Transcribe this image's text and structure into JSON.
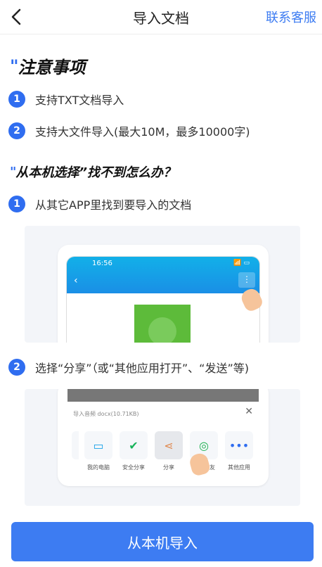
{
  "nav": {
    "title": "导入文档",
    "right_link": "联系客服"
  },
  "notes": {
    "title": "注意事项",
    "items": [
      {
        "num": "1",
        "text": "支持TXT文档导入"
      },
      {
        "num": "2",
        "text": "支持大文件导入(最大10M，最多10000字)"
      }
    ]
  },
  "help": {
    "title": "从本机选择”找不到怎么办？",
    "steps": [
      {
        "num": "1",
        "text": "从其它APP里找到要导入的文档"
      },
      {
        "num": "2",
        "text": "选择“分享”（或“其他应用打开”、“发送”等)"
      }
    ]
  },
  "illustration1": {
    "time": "16:56",
    "status": "📶 ▭"
  },
  "illustration2": {
    "file_name": "导入音频 docx(10.71KB)",
    "apps": [
      {
        "label": "我的电脑",
        "icon": "computer-icon"
      },
      {
        "label": "安全分享",
        "icon": "shield-icon"
      },
      {
        "label": "分享",
        "icon": "share-icon"
      },
      {
        "label": "微信好友",
        "icon": "wechat-icon"
      },
      {
        "label": "其他应用",
        "icon": "more-icon"
      }
    ]
  },
  "cta": {
    "label": "从本机导入"
  },
  "colors": {
    "accent": "#3d7cf2",
    "blue": "#2f6df0"
  }
}
